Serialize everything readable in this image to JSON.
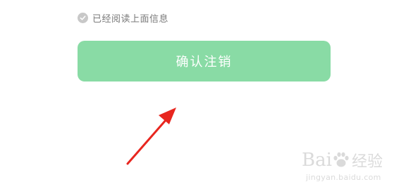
{
  "agreement": {
    "checkbox_icon": "check-circle-icon",
    "label": "已经阅读上面信息"
  },
  "confirm_button": {
    "label": "确认注销",
    "color": "#89dba5"
  },
  "annotation": {
    "icon": "red-arrow-icon",
    "color": "#e8261f"
  },
  "watermark": {
    "brand_latin": "Bai",
    "brand_suffix": "经验",
    "url": "jingyan.baidu.com"
  }
}
